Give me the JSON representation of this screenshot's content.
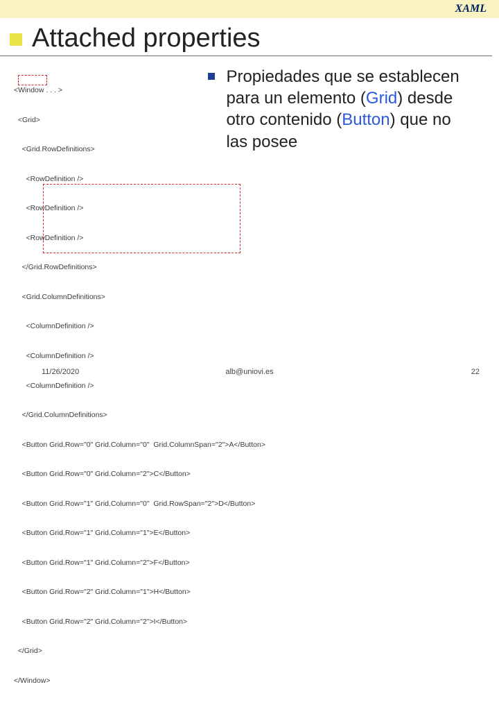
{
  "header": {
    "label": "XAML"
  },
  "title": "Attached properties",
  "bullet": {
    "pre1": "Propiedades que se establecen para un elemento (",
    "grid": "Grid",
    "mid": ") desde otro contenido (",
    "button": "Button",
    "post": ") que no las posee"
  },
  "code": {
    "l1": "<Window . . . >",
    "l2": "  <Grid>",
    "l3": "    <Grid.RowDefinitions>",
    "l4": "      <RowDefinition />",
    "l5": "      <RowDefinition />",
    "l6": "      <RowDefinition />",
    "l7": "    </Grid.RowDefinitions>",
    "l8": "    <Grid.ColumnDefinitions>",
    "l9": "      <ColumnDefinition />",
    "l10": "      <ColumnDefinition />",
    "l11": "      <ColumnDefinition />",
    "l12": "    </Grid.ColumnDefinitions>",
    "b1a": "    <Button ",
    "b1b": "Grid.Row=\"0\" Grid.Column=\"0\"  Grid.ColumnSpan=\"2\"",
    "b1c": ">A</Button>",
    "b2a": "    <Button ",
    "b2b": "Grid.Row=\"0\" Grid.Column=\"2\"",
    "b2c": ">C</Button>",
    "b3a": "    <Button ",
    "b3b": "Grid.Row=\"1\" Grid.Column=\"0\"  Grid.RowSpan=\"2\"",
    "b3c": ">D</Button>",
    "b4a": "    <Button ",
    "b4b": "Grid.Row=\"1\" Grid.Column=\"1\"",
    "b4c": ">E</Button>",
    "b5a": "    <Button ",
    "b5b": "Grid.Row=\"1\" Grid.Column=\"2\"",
    "b5c": ">F</Button>",
    "b6a": "    <Button ",
    "b6b": "Grid.Row=\"2\" Grid.Column=\"1\"",
    "b6c": ">H</Button>",
    "b7a": "    <Button ",
    "b7b": "Grid.Row=\"2\" Grid.Column=\"2\"",
    "b7c": ">I</Button>",
    "l20": "  </Grid>",
    "l21": "</Window>"
  },
  "footer": {
    "date": "11/26/2020",
    "email": "alb@uniovi.es",
    "page": "22"
  }
}
